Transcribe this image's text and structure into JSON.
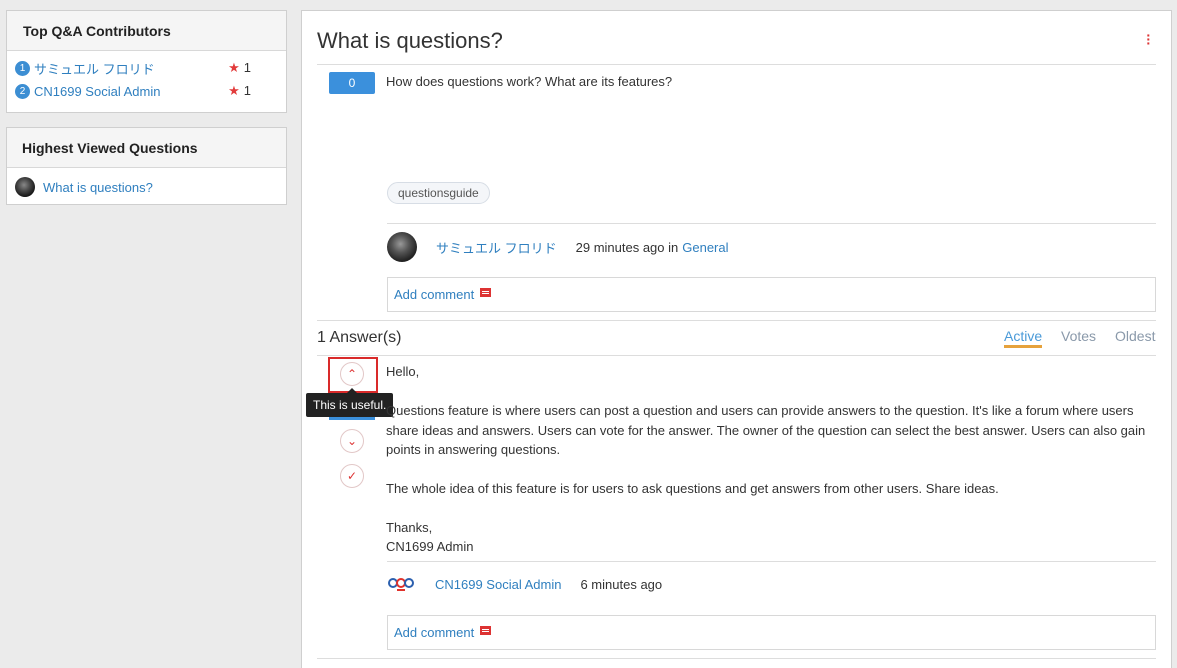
{
  "sidebar": {
    "contributors": {
      "title": "Top Q&A Contributors",
      "items": [
        {
          "rank": "1",
          "name": "サミュエル フロリド",
          "score": "1"
        },
        {
          "rank": "2",
          "name": "CN1699 Social Admin",
          "score": "1"
        }
      ]
    },
    "highest_viewed": {
      "title": "Highest Viewed Questions",
      "items": [
        {
          "label": "What is questions?"
        }
      ]
    }
  },
  "question": {
    "title": "What is questions?",
    "votes": "0",
    "body": "How does questions work? What are its features?",
    "tag": "questionsguide",
    "author": "サミュエル フロリド",
    "time": "29 minutes ago in",
    "category": "General",
    "add_comment": "Add comment"
  },
  "answers": {
    "count_label": "1 Answer(s)",
    "sort_tabs": [
      "Active",
      "Votes",
      "Oldest"
    ],
    "active_tab": "Active",
    "tooltip": "This is useful.",
    "answer": {
      "greeting": "Hello,",
      "paragraph1": "Questions feature is where users can post a question and users can provide answers to the question. It's like a forum where users share ideas and answers. Users can vote for the answer. The owner of the question can select the best answer. Users can also gain points in answering questions.",
      "paragraph2": "The whole idea of this feature is for users to ask questions and get answers from other users. Share ideas.",
      "closing": "Thanks,",
      "signature": "CN1699 Admin",
      "author": "CN1699 Social Admin",
      "time": "6 minutes ago",
      "add_comment": "Add comment"
    }
  },
  "colors": {
    "accent": "#3b90dc",
    "link": "#2f7fbf",
    "danger": "#d33",
    "tab_underline": "#e6a23c"
  }
}
